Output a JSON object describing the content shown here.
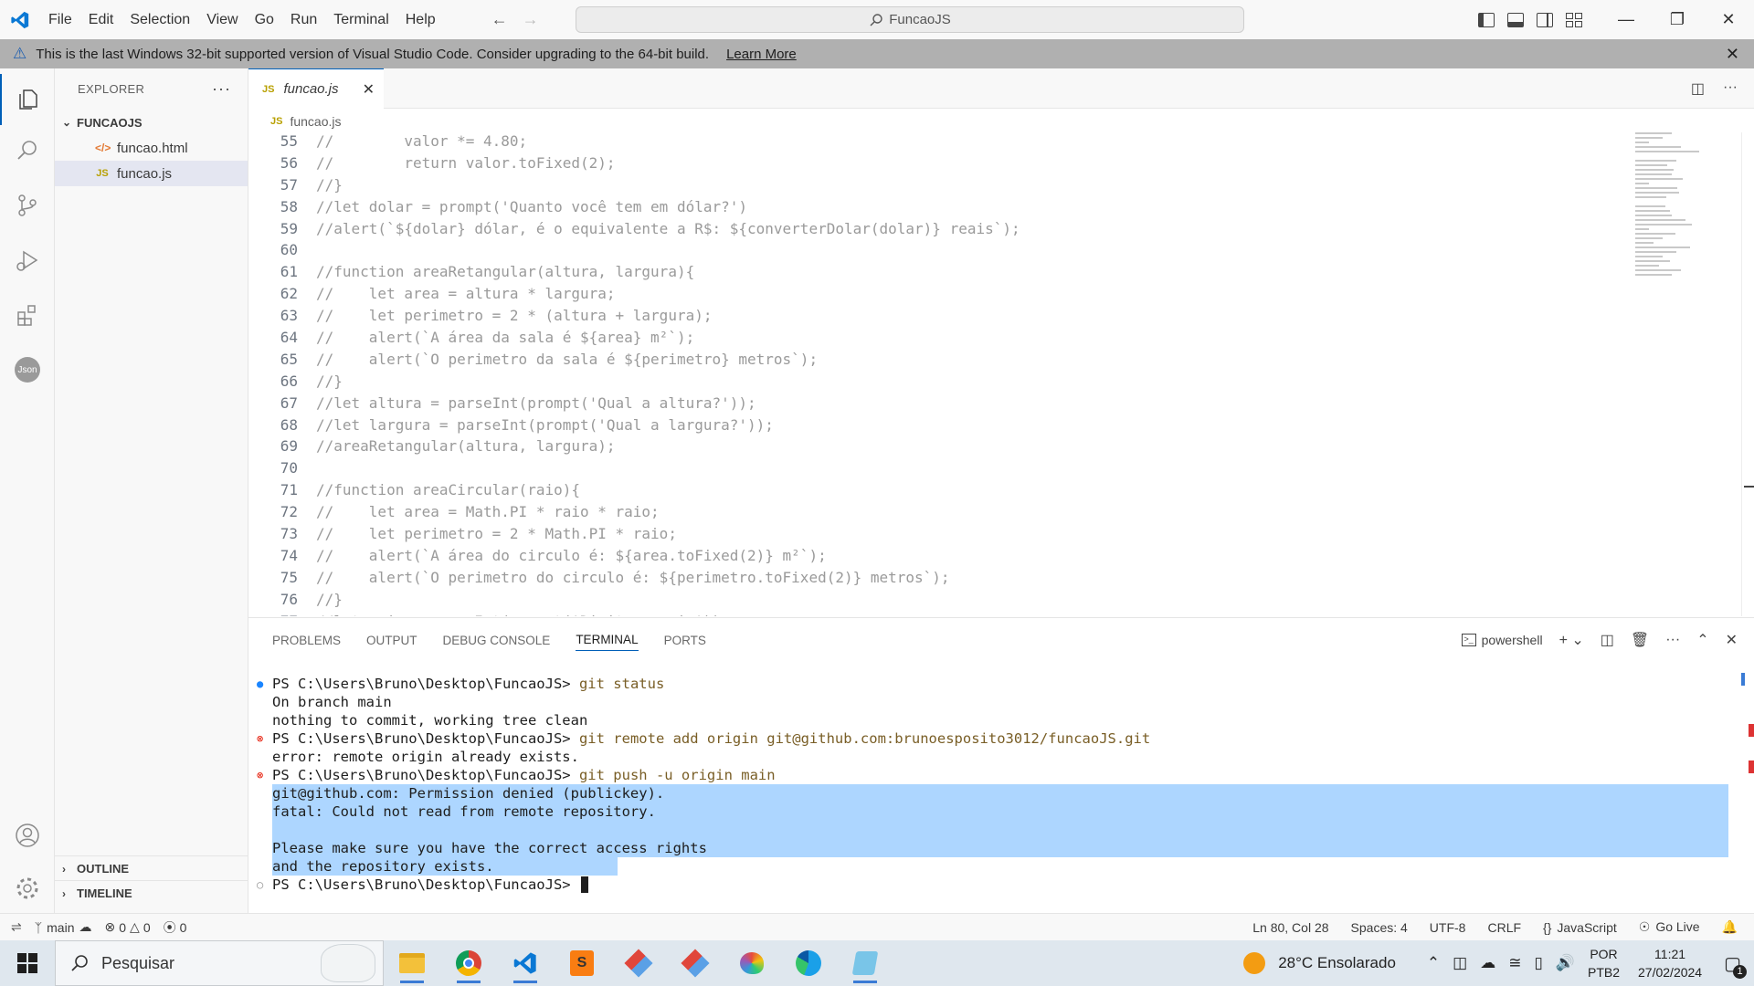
{
  "titlebar": {
    "menu": [
      "File",
      "Edit",
      "Selection",
      "View",
      "Go",
      "Run",
      "Terminal",
      "Help"
    ],
    "command_center": "FuncaoJS"
  },
  "banner": {
    "message": "This is the last Windows 32-bit supported version of Visual Studio Code. Consider upgrading to the 64-bit build.",
    "link": "Learn More"
  },
  "explorer": {
    "title": "EXPLORER",
    "folder": "FUNCAOJS",
    "files": [
      {
        "name": "funcao.html",
        "icon": "html"
      },
      {
        "name": "funcao.js",
        "icon": "js"
      }
    ],
    "outline": "OUTLINE",
    "timeline": "TIMELINE"
  },
  "editor": {
    "tab": "funcao.js",
    "breadcrumb": "funcao.js",
    "lines": [
      {
        "n": "55",
        "t": "//        valor *= 4.80;"
      },
      {
        "n": "56",
        "t": "//        return valor.toFixed(2);"
      },
      {
        "n": "57",
        "t": "//}"
      },
      {
        "n": "58",
        "t": "//let dolar = prompt('Quanto você tem em dólar?')"
      },
      {
        "n": "59",
        "t": "//alert(`${dolar} dólar, é o equivalente a R$: ${converterDolar(dolar)} reais`);"
      },
      {
        "n": "60",
        "t": ""
      },
      {
        "n": "61",
        "t": "//function areaRetangular(altura, largura){"
      },
      {
        "n": "62",
        "t": "//    let area = altura * largura;"
      },
      {
        "n": "63",
        "t": "//    let perimetro = 2 * (altura + largura);"
      },
      {
        "n": "64",
        "t": "//    alert(`A área da sala é ${area} m²`);"
      },
      {
        "n": "65",
        "t": "//    alert(`O perimetro da sala é ${perimetro} metros`);"
      },
      {
        "n": "66",
        "t": "//}"
      },
      {
        "n": "67",
        "t": "//let altura = parseInt(prompt('Qual a altura?'));"
      },
      {
        "n": "68",
        "t": "//let largura = parseInt(prompt('Qual a largura?'));"
      },
      {
        "n": "69",
        "t": "//areaRetangular(altura, largura);"
      },
      {
        "n": "70",
        "t": ""
      },
      {
        "n": "71",
        "t": "//function areaCircular(raio){"
      },
      {
        "n": "72",
        "t": "//    let area = Math.PI * raio * raio;"
      },
      {
        "n": "73",
        "t": "//    let perimetro = 2 * Math.PI * raio;"
      },
      {
        "n": "74",
        "t": "//    alert(`A área do circulo é: ${area.toFixed(2)} m²`);"
      },
      {
        "n": "75",
        "t": "//    alert(`O perimetro do circulo é: ${perimetro.toFixed(2)} metros`);"
      },
      {
        "n": "76",
        "t": "//}"
      },
      {
        "n": "77",
        "t": "//let raio = parseInt(prompt('Digite o raio'));"
      }
    ]
  },
  "panel": {
    "tabs": [
      "PROBLEMS",
      "OUTPUT",
      "DEBUG CONSOLE",
      "TERMINAL",
      "PORTS"
    ],
    "active_tab": "TERMINAL",
    "shell": "powershell",
    "terminal": [
      {
        "dot": "blue",
        "prompt": "PS C:\\Users\\Bruno\\Desktop\\FuncaoJS> ",
        "cmd": "git status"
      },
      {
        "text": "On branch main"
      },
      {
        "text": "nothing to commit, working tree clean"
      },
      {
        "dot": "red",
        "prompt": "PS C:\\Users\\Bruno\\Desktop\\FuncaoJS> ",
        "cmd": "git remote add origin git@github.com:brunoesposito3012/funcaoJS.git"
      },
      {
        "text": "error: remote origin already exists."
      },
      {
        "dot": "red",
        "prompt": "PS C:\\Users\\Bruno\\Desktop\\FuncaoJS> ",
        "cmd": "git push -u origin main"
      },
      {
        "text": "git@github.com: Permission denied (publickey).",
        "hl": "full"
      },
      {
        "text": "fatal: Could not read from remote repository.",
        "hl": "full"
      },
      {
        "text": "",
        "hl": "full"
      },
      {
        "text": "Please make sure you have the correct access rights",
        "hl": "full"
      },
      {
        "text": "and the repository exists.",
        "hl": "part"
      },
      {
        "dot": "empty",
        "prompt": "PS C:\\Users\\Bruno\\Desktop\\FuncaoJS> ",
        "cmd": "",
        "cursor": true
      }
    ]
  },
  "statusbar": {
    "branch": "main",
    "errors": "0",
    "warnings": "0",
    "ports": "0",
    "position": "Ln 80, Col 28",
    "spaces": "Spaces: 4",
    "encoding": "UTF-8",
    "eol": "CRLF",
    "language": "JavaScript",
    "golive": "Go Live"
  },
  "taskbar": {
    "search": "Pesquisar",
    "weather": "28°C  Ensolarado",
    "lang1": "POR",
    "lang2": "PTB2",
    "time": "11:21",
    "date": "27/02/2024",
    "notifications": "1"
  }
}
